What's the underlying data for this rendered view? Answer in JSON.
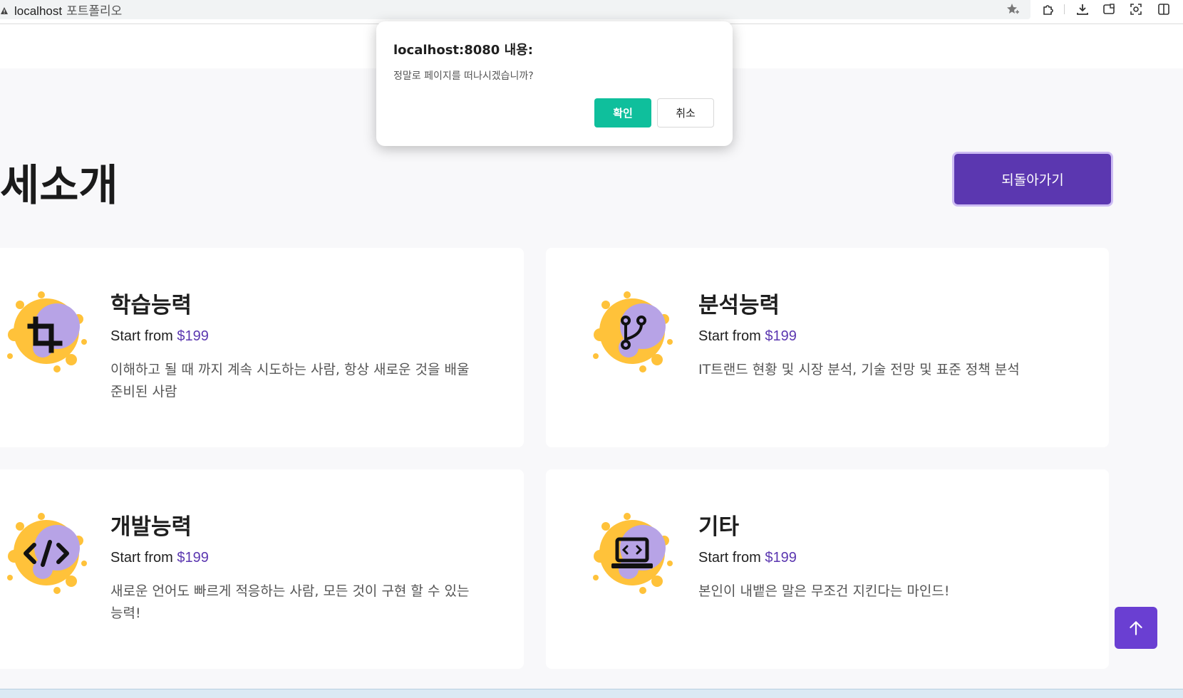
{
  "browser": {
    "url": "localhost",
    "tab_title": "포트폴리오",
    "icons": [
      "not-secure-icon",
      "star-plus-icon",
      "extensions-icon",
      "download-icon",
      "screenshot-icon",
      "capture-icon",
      "split-view-icon"
    ]
  },
  "page": {
    "title": "세소개",
    "back_label": "되돌아가기"
  },
  "cards": [
    {
      "title": "학습능력",
      "price_prefix": "Start from",
      "price": "$199",
      "desc": "이해하고 될 때 까지 계속 시도하는 사람, 항상 새로운 것을 배울 준비된 사람",
      "icon": "crop-icon"
    },
    {
      "title": "분석능력",
      "price_prefix": "Start from",
      "price": "$199",
      "desc": "IT트랜드 현황 및 시장 분석, 기술 전망 및 표준 정책 분석",
      "icon": "git-branch-icon"
    },
    {
      "title": "개발능력",
      "price_prefix": "Start from",
      "price": "$199",
      "desc": "새로운 언어도 빠르게 적응하는 사람, 모든 것이 구현 할 수 있는 능력!",
      "icon": "code-icon"
    },
    {
      "title": "기타",
      "price_prefix": "Start from",
      "price": "$199",
      "desc": "본인이 내뱉은 말은 무조건 지킨다는 마인드!",
      "icon": "laptop-code-icon"
    }
  ],
  "dialog": {
    "title": "localhost:8080 내용:",
    "message": "정말로 페이지를 떠나시겠습니까?",
    "ok_label": "확인",
    "cancel_label": "취소"
  },
  "colors": {
    "accent_purple": "#5b37b0",
    "scroll_top_purple": "#6a3fd2",
    "ok_green": "#0fbf9c",
    "splash_yellow": "#ffc23a",
    "splash_lavender": "#b7a3e6"
  }
}
